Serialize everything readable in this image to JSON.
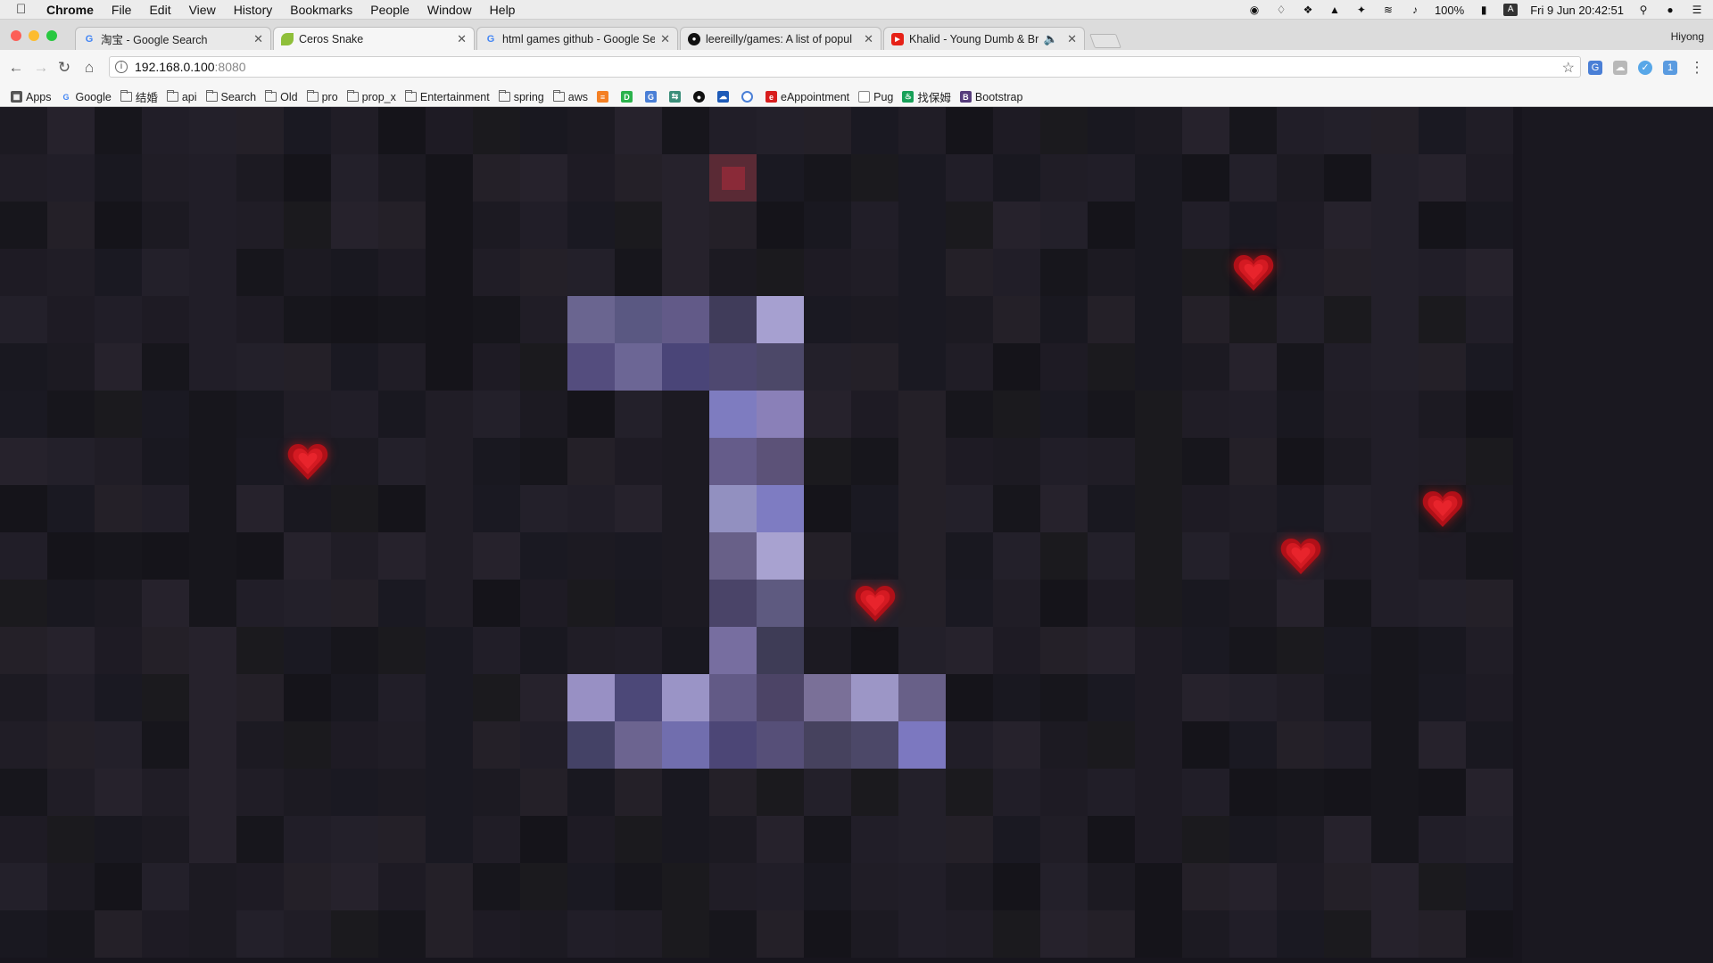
{
  "menubar": {
    "app_name": "Chrome",
    "items": [
      "File",
      "Edit",
      "View",
      "History",
      "Bookmarks",
      "People",
      "Window",
      "Help"
    ],
    "battery": "100%",
    "datetime": "Fri 9 Jun  20:42:51"
  },
  "tabs": [
    {
      "title": "淘宝 - Google Search",
      "favicon": "google-icon",
      "active": false
    },
    {
      "title": "Ceros Snake",
      "favicon": "leaf-icon",
      "active": true
    },
    {
      "title": "html games github - Google Se",
      "favicon": "google-icon",
      "active": false
    },
    {
      "title": "leereilly/games: A list of popul",
      "favicon": "github-icon",
      "active": false
    },
    {
      "title": "Khalid - Young Dumb & Bro",
      "favicon": "youtube-icon",
      "active": false
    }
  ],
  "profile_name": "Hiyong",
  "omnibox": {
    "host": "192.168.0.100",
    "port": ":8080"
  },
  "bookmarks": [
    {
      "label": "Apps",
      "icon": "apps-grid-icon"
    },
    {
      "label": "Google",
      "icon": "google-icon"
    },
    {
      "label": "结婚",
      "icon": "folder-icon"
    },
    {
      "label": "api",
      "icon": "folder-icon"
    },
    {
      "label": "Search",
      "icon": "folder-icon"
    },
    {
      "label": "Old",
      "icon": "folder-icon"
    },
    {
      "label": "pro",
      "icon": "folder-icon"
    },
    {
      "label": "prop_x",
      "icon": "folder-icon"
    },
    {
      "label": "Entertainment",
      "icon": "folder-icon"
    },
    {
      "label": "spring",
      "icon": "folder-icon"
    },
    {
      "label": "aws",
      "icon": "folder-icon"
    },
    {
      "label": "",
      "icon": "stack-icon"
    },
    {
      "label": "",
      "icon": "d-icon"
    },
    {
      "label": "",
      "icon": "translate-icon"
    },
    {
      "label": "",
      "icon": "translate2-icon"
    },
    {
      "label": "",
      "icon": "github-icon"
    },
    {
      "label": "",
      "icon": "cloud-icon"
    },
    {
      "label": "",
      "icon": "circle-icon"
    },
    {
      "label": "eAppointment",
      "icon": "eappointment-icon"
    },
    {
      "label": "Pug",
      "icon": "page-icon"
    },
    {
      "label": "找保姆",
      "icon": "nanny-icon"
    },
    {
      "label": "Bootstrap",
      "icon": "bootstrap-icon"
    }
  ],
  "game": {
    "grid_cols": 32,
    "grid_rows": 18,
    "snake": [
      {
        "c": 12,
        "r": 4,
        "color": "#6a6590"
      },
      {
        "c": 13,
        "r": 4,
        "color": "#5a5882"
      },
      {
        "c": 14,
        "r": 4,
        "color": "#625a88"
      },
      {
        "c": 15,
        "r": 4,
        "color": "#403c5a"
      },
      {
        "c": 16,
        "r": 4,
        "color": "#a6a0d0"
      },
      {
        "c": 12,
        "r": 5,
        "color": "#544d7e"
      },
      {
        "c": 13,
        "r": 5,
        "color": "#6c6695"
      },
      {
        "c": 14,
        "r": 5,
        "color": "#4a4578"
      },
      {
        "c": 15,
        "r": 5,
        "color": "#4e4870"
      },
      {
        "c": 16,
        "r": 5,
        "color": "#4c4868"
      },
      {
        "c": 15,
        "r": 6,
        "color": "#7e7cc0"
      },
      {
        "c": 16,
        "r": 6,
        "color": "#8a80b8"
      },
      {
        "c": 15,
        "r": 7,
        "color": "#655c8a"
      },
      {
        "c": 16,
        "r": 7,
        "color": "#5c5278"
      },
      {
        "c": 15,
        "r": 8,
        "color": "#9290c0"
      },
      {
        "c": 16,
        "r": 8,
        "color": "#7e7cc2"
      },
      {
        "c": 15,
        "r": 9,
        "color": "#686088"
      },
      {
        "c": 16,
        "r": 9,
        "color": "#a8a2d0"
      },
      {
        "c": 15,
        "r": 10,
        "color": "#4a4468"
      },
      {
        "c": 16,
        "r": 10,
        "color": "#5e5a80"
      },
      {
        "c": 15,
        "r": 11,
        "color": "#776ea0"
      },
      {
        "c": 16,
        "r": 11,
        "color": "#3e3c56"
      },
      {
        "c": 12,
        "r": 12,
        "color": "#9890c4"
      },
      {
        "c": 13,
        "r": 12,
        "color": "#4c4878"
      },
      {
        "c": 14,
        "r": 12,
        "color": "#9a94c6"
      },
      {
        "c": 15,
        "r": 12,
        "color": "#625a86"
      },
      {
        "c": 16,
        "r": 12,
        "color": "#4c4466"
      },
      {
        "c": 17,
        "r": 12,
        "color": "#7a7098"
      },
      {
        "c": 18,
        "r": 12,
        "color": "#9c96c6"
      },
      {
        "c": 19,
        "r": 12,
        "color": "#686088"
      },
      {
        "c": 12,
        "r": 13,
        "color": "#444266"
      },
      {
        "c": 13,
        "r": 13,
        "color": "#6c6490"
      },
      {
        "c": 14,
        "r": 13,
        "color": "#716eae"
      },
      {
        "c": 15,
        "r": 13,
        "color": "#4c4676"
      },
      {
        "c": 16,
        "r": 13,
        "color": "#564f78"
      },
      {
        "c": 17,
        "r": 13,
        "color": "#46425e"
      },
      {
        "c": 18,
        "r": 13,
        "color": "#4c4868"
      },
      {
        "c": 19,
        "r": 13,
        "color": "#7c78c0"
      }
    ],
    "food": {
      "c": 15,
      "r": 1
    },
    "hearts": [
      {
        "c": 26,
        "r": 3
      },
      {
        "c": 6,
        "r": 7
      },
      {
        "c": 30,
        "r": 8
      },
      {
        "c": 27,
        "r": 9
      },
      {
        "c": 18,
        "r": 10
      }
    ],
    "tile_colors": [
      "#1c1a22",
      "#201d26",
      "#17161c",
      "#1e1b24",
      "#23202a",
      "#191820",
      "#1a1922",
      "#26222c",
      "#15141a",
      "#211e28",
      "#1b1a1e",
      "#242028"
    ]
  }
}
